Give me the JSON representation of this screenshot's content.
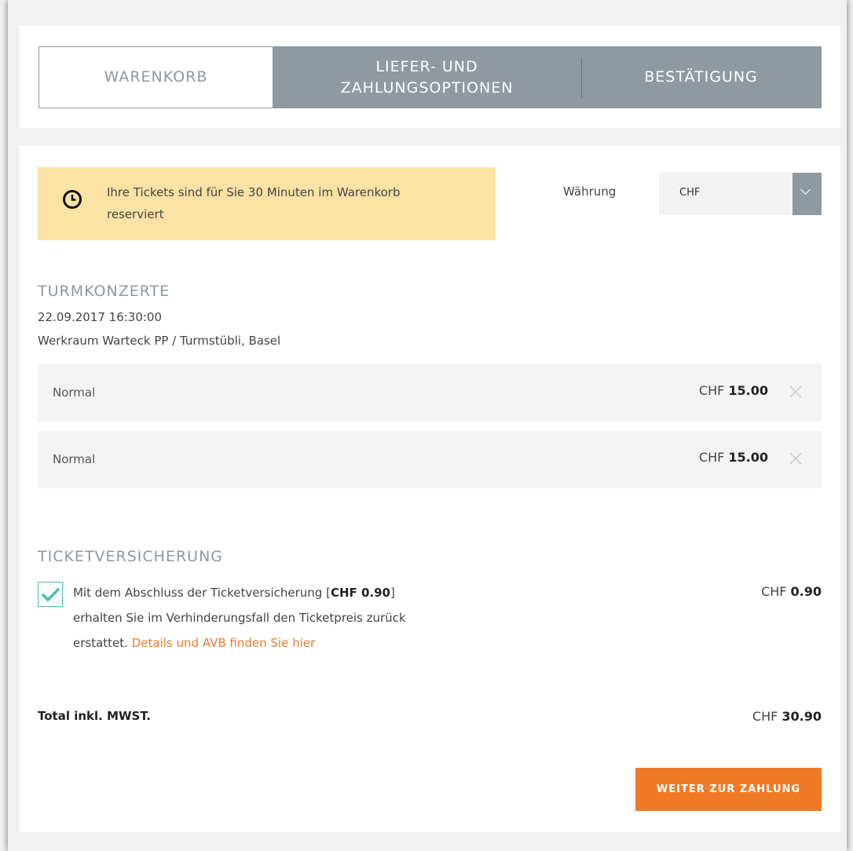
{
  "steps": {
    "step1": "WARENKORB",
    "step2_line1": "LIEFER- UND",
    "step2_line2": "ZAHLUNGSOPTIONEN",
    "step3": "BESTÄTIGUNG"
  },
  "notice": {
    "icon": "clock-icon",
    "line1": "Ihre Tickets sind für Sie 30 Minuten im Warenkorb",
    "line2": "reserviert"
  },
  "currency": {
    "label": "Währung",
    "selected": "CHF"
  },
  "event": {
    "title": "TURMKONZERTE",
    "datetime": "22.09.2017 16:30:00",
    "venue": "Werkraum Warteck PP / Turmstübli, Basel"
  },
  "tickets": [
    {
      "name": "Normal",
      "currency": "CHF",
      "price": "15.00"
    },
    {
      "name": "Normal",
      "currency": "CHF",
      "price": "15.00"
    }
  ],
  "insurance": {
    "title": "TICKETVERSICHERUNG",
    "checked": true,
    "text_part1": "Mit dem Abschluss der Ticketversicherung [",
    "text_bold": "CHF 0.90",
    "text_part2": "]",
    "text_line2": "erhalten Sie im Verhinderungsfall den Ticketpreis zurück",
    "text_line3": "erstattet.",
    "link": "Details und AVB finden Sie hier",
    "price_currency": "CHF",
    "price": "0.90"
  },
  "total": {
    "label": "Total inkl. MWST.",
    "currency": "CHF",
    "amount": "30.90"
  },
  "pay_button": "WEITER ZUR ZAHLUNG",
  "colors": {
    "accent": "#f07a26",
    "notice_bg": "#fbe2a5",
    "step_bg": "#8f999f",
    "check": "#4abfb0"
  }
}
